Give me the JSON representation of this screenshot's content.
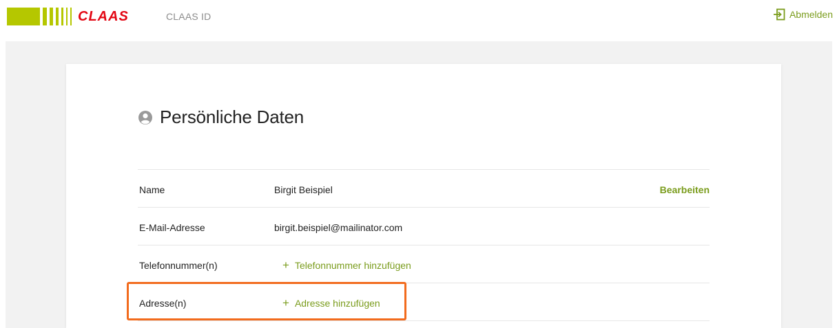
{
  "header": {
    "brand": "CLAAS",
    "app_title": "CLAAS ID",
    "logout_label": "Abmelden"
  },
  "page": {
    "title": "Persönliche Daten"
  },
  "rows": [
    {
      "label": "Name",
      "value": "Birgit Beispiel",
      "action": "Bearbeiten"
    },
    {
      "label": "E-Mail-Adresse",
      "value": "birgit.beispiel@mailinator.com"
    },
    {
      "label": "Telefonnummer(n)",
      "add_action": "Telefonnummer hinzufügen"
    },
    {
      "label": "Adresse(n)",
      "add_action": "Adresse hinzufügen"
    }
  ],
  "colors": {
    "brand_green": "#b5c700",
    "brand_red": "#e30613",
    "link_green": "#7a9c1c",
    "highlight_orange": "#f26b1d"
  }
}
